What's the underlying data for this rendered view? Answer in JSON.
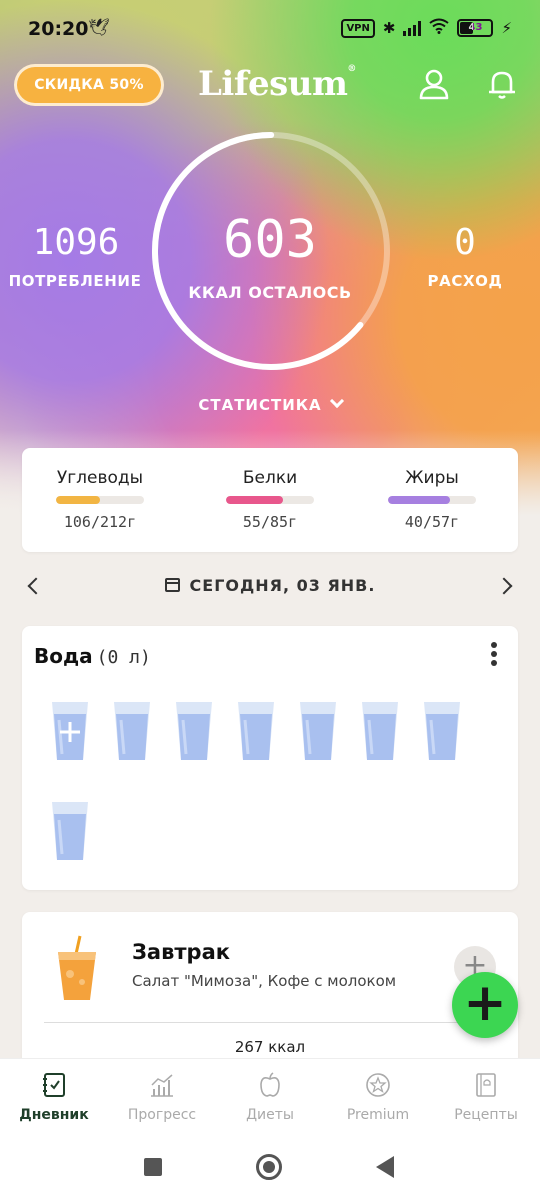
{
  "status_bar": {
    "time": "20:20",
    "vpn": "VPN",
    "battery": "43"
  },
  "header": {
    "discount_label": "СКИДКА 50%",
    "logo": "Lifesum",
    "logo_mark": "®"
  },
  "summary": {
    "eaten_value": "1096",
    "eaten_label": "ПОТРЕБЛЕНИЕ",
    "remaining_value": "603",
    "remaining_label": "ККАЛ ОСТАЛОСЬ",
    "burned_value": "0",
    "burned_label": "РАСХОД",
    "ring_progress": 0.64,
    "stats_label": "СТАТИСТИКА"
  },
  "macros": [
    {
      "name": "Углеводы",
      "value": "106/212г",
      "progress": 0.5,
      "color": "#f2b543"
    },
    {
      "name": "Белки",
      "value": "55/85г",
      "progress": 0.65,
      "color": "#e8578c"
    },
    {
      "name": "Жиры",
      "value": "40/57г",
      "progress": 0.7,
      "color": "#a67fe0"
    }
  ],
  "date_nav": {
    "label": "СЕГОДНЯ, 03 ЯНВ."
  },
  "water": {
    "title": "Вода",
    "amount": "(0 л)",
    "glass_count": 8
  },
  "meal": {
    "title": "Завтрак",
    "items": "Салат \"Мимоза\", Кофе с молоком",
    "kcal": "267 ккал",
    "add_symbol": "+"
  },
  "fab": {
    "symbol": "+"
  },
  "tabs": [
    {
      "label": "Дневник",
      "icon": "diary-icon",
      "active": true
    },
    {
      "label": "Прогресс",
      "icon": "progress-chart-icon",
      "active": false
    },
    {
      "label": "Диеты",
      "icon": "apple-icon",
      "active": false
    },
    {
      "label": "Premium",
      "icon": "star-badge-icon",
      "active": false
    },
    {
      "label": "Рецепты",
      "icon": "recipe-book-icon",
      "active": false
    }
  ],
  "colors": {
    "accent_green": "#3cd652",
    "discount": "#f7b240",
    "active_tab": "#1f3f2a"
  }
}
